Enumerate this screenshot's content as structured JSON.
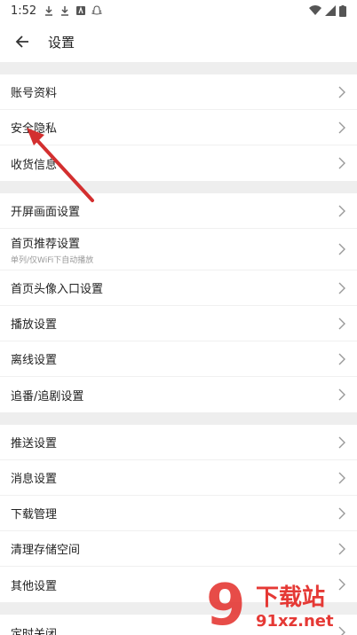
{
  "status_bar": {
    "time": "1:52"
  },
  "header": {
    "title": "设置"
  },
  "groups": [
    {
      "items": [
        {
          "label": "账号资料"
        },
        {
          "label": "安全隐私"
        },
        {
          "label": "收货信息"
        }
      ]
    },
    {
      "items": [
        {
          "label": "开屏画面设置"
        },
        {
          "label": "首页推荐设置",
          "sub": "单列/仅WiFi下自动播放"
        },
        {
          "label": "首页头像入口设置"
        },
        {
          "label": "播放设置"
        },
        {
          "label": "离线设置"
        },
        {
          "label": "追番/追剧设置"
        }
      ]
    },
    {
      "items": [
        {
          "label": "推送设置"
        },
        {
          "label": "消息设置"
        },
        {
          "label": "下载管理"
        },
        {
          "label": "清理存储空间"
        },
        {
          "label": "其他设置"
        }
      ]
    },
    {
      "items": [
        {
          "label": "定时关闭"
        }
      ]
    }
  ],
  "watermark": {
    "brand": "9",
    "site_cn": "下载站",
    "site_url": "91xz.net"
  },
  "colors": {
    "annotation_arrow": "#d32f2f",
    "watermark": "#e53935",
    "background": "#eeeeee"
  }
}
